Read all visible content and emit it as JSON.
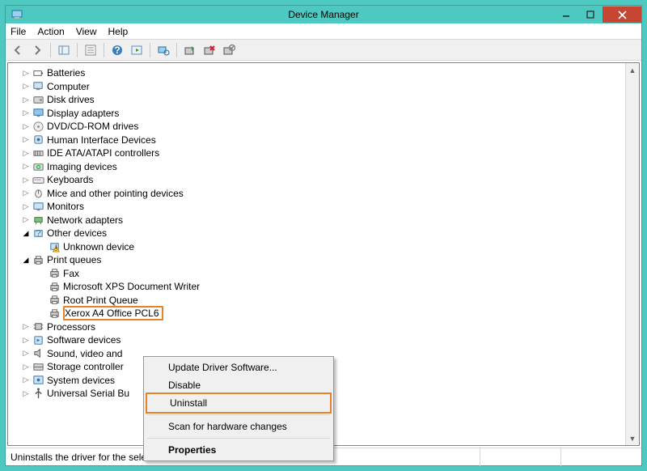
{
  "window": {
    "title": "Device Manager"
  },
  "menu": {
    "file": "File",
    "action": "Action",
    "view": "View",
    "help": "Help"
  },
  "tree": {
    "items": [
      {
        "label": "Batteries",
        "icon": "battery"
      },
      {
        "label": "Computer",
        "icon": "computer"
      },
      {
        "label": "Disk drives",
        "icon": "disk"
      },
      {
        "label": "Display adapters",
        "icon": "display"
      },
      {
        "label": "DVD/CD-ROM drives",
        "icon": "cd"
      },
      {
        "label": "Human Interface Devices",
        "icon": "hid"
      },
      {
        "label": "IDE ATA/ATAPI controllers",
        "icon": "ide"
      },
      {
        "label": "Imaging devices",
        "icon": "imaging"
      },
      {
        "label": "Keyboards",
        "icon": "keyboard"
      },
      {
        "label": "Mice and other pointing devices",
        "icon": "mouse"
      },
      {
        "label": "Monitors",
        "icon": "monitor"
      },
      {
        "label": "Network adapters",
        "icon": "network"
      },
      {
        "label": "Other devices",
        "icon": "other",
        "expanded": true,
        "children": [
          {
            "label": "Unknown device",
            "icon": "warn"
          }
        ]
      },
      {
        "label": "Print queues",
        "icon": "printer",
        "expanded": true,
        "children": [
          {
            "label": "Fax",
            "icon": "printer"
          },
          {
            "label": "Microsoft XPS Document Writer",
            "icon": "printer"
          },
          {
            "label": "Root Print Queue",
            "icon": "printer"
          },
          {
            "label": "Xerox A4 Office PCL6",
            "icon": "printer",
            "highlight": true
          }
        ]
      },
      {
        "label": "Processors",
        "icon": "cpu"
      },
      {
        "label": "Software devices",
        "icon": "software"
      },
      {
        "label": "Sound, video and",
        "icon": "sound",
        "truncated": true
      },
      {
        "label": "Storage controller",
        "icon": "storage",
        "truncated": true
      },
      {
        "label": "System devices",
        "icon": "system"
      },
      {
        "label": "Universal Serial Bu",
        "icon": "usb",
        "truncated": true
      }
    ]
  },
  "context_menu": {
    "items": [
      {
        "label": "Update Driver Software..."
      },
      {
        "label": "Disable"
      },
      {
        "label": "Uninstall",
        "highlight": true
      },
      {
        "sep": true
      },
      {
        "label": "Scan for hardware changes"
      },
      {
        "sep": true
      },
      {
        "label": "Properties",
        "bold": true
      }
    ]
  },
  "status": {
    "text": "Uninstalls the driver for the selected device."
  }
}
